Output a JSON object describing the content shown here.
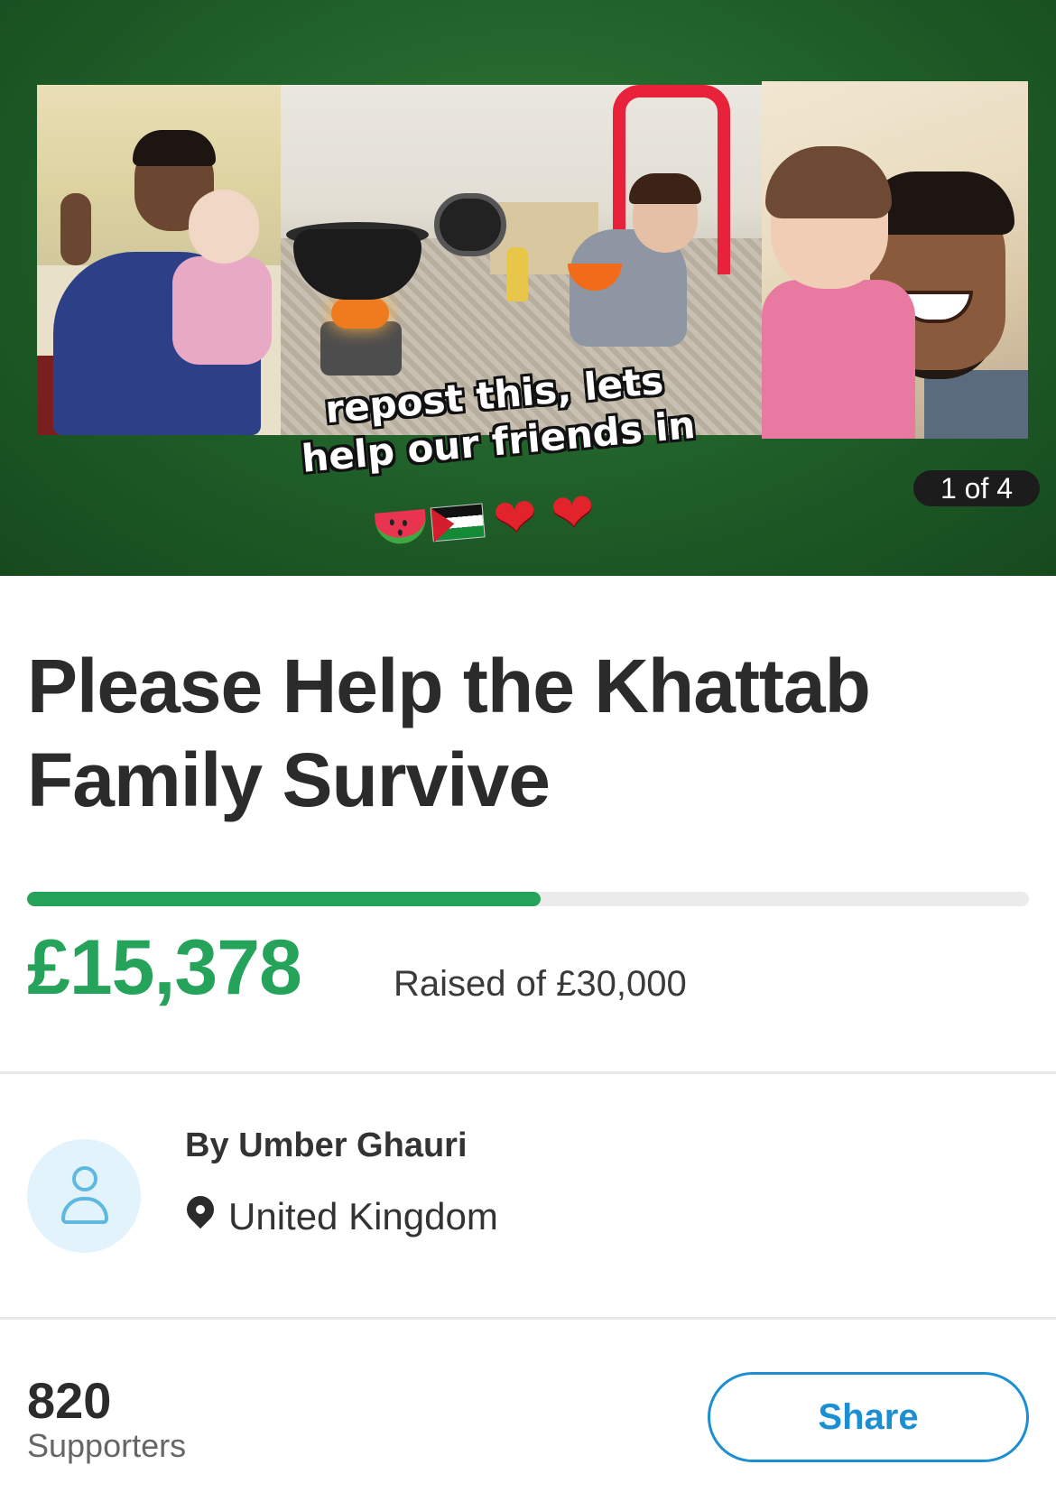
{
  "gallery": {
    "overlay_text": "repost this, lets\nhelp our friends in",
    "counter": "1 of 4",
    "emojis": [
      "watermelon-emoji",
      "palestine-flag-emoji",
      "red-heart-emoji",
      "red-heart-emoji"
    ],
    "background_color": "#1f5e28"
  },
  "campaign": {
    "title": "Please Help the Khattab Family Survive",
    "raised": "£15,378",
    "raised_of": "Raised of £30,000",
    "progress_fraction": 0.513,
    "accent_color": "#26a35b"
  },
  "organizer": {
    "name": "By Umber Ghauri",
    "location": "United Kingdom",
    "avatar_icon": "person-icon",
    "location_icon": "map-pin-icon"
  },
  "supporters": {
    "count": "820",
    "label": "Supporters"
  },
  "actions": {
    "share_label": "Share",
    "share_color": "#1b8fd2"
  }
}
